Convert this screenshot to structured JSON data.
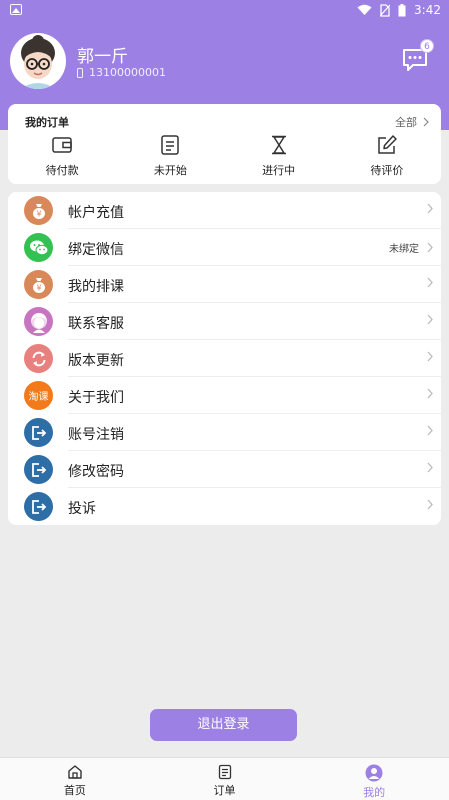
{
  "status": {
    "time": "3:42"
  },
  "profile": {
    "name": "郭一斤",
    "phone": "13100000001",
    "message_badge": "6"
  },
  "orders": {
    "title": "我的订单",
    "all_label": "全部",
    "items": [
      {
        "label": "待付款",
        "icon": "wallet-icon"
      },
      {
        "label": "未开始",
        "icon": "list-icon"
      },
      {
        "label": "进行中",
        "icon": "hourglass-icon"
      },
      {
        "label": "待评价",
        "icon": "edit-icon"
      }
    ]
  },
  "menu": {
    "items": [
      {
        "label": "帐户充值",
        "icon": "money-bag-icon",
        "color": "#d9885a"
      },
      {
        "label": "绑定微信",
        "icon": "wechat-icon",
        "color": "#33c152",
        "status": "未绑定"
      },
      {
        "label": "我的排课",
        "icon": "money-bag-icon",
        "color": "#d9885a"
      },
      {
        "label": "联系客服",
        "icon": "service-avatar-icon",
        "color": "#c774c1"
      },
      {
        "label": "版本更新",
        "icon": "refresh-icon",
        "color": "#e8817d"
      },
      {
        "label": "关于我们",
        "icon": "taoke-logo-icon",
        "color": "#f27a1a",
        "icon_text": "淘课"
      },
      {
        "label": "账号注销",
        "icon": "exit-icon",
        "color": "#2d6ea7"
      },
      {
        "label": "修改密码",
        "icon": "exit-icon",
        "color": "#2d6ea7"
      },
      {
        "label": "投诉",
        "icon": "exit-icon",
        "color": "#2d6ea7"
      }
    ]
  },
  "logout_label": "退出登录",
  "tabs": [
    {
      "label": "首页",
      "icon": "home-icon"
    },
    {
      "label": "订单",
      "icon": "list-icon"
    },
    {
      "label": "我的",
      "icon": "user-icon",
      "active": true
    }
  ],
  "colors": {
    "primary": "#9d80e4",
    "background": "#ececec"
  }
}
